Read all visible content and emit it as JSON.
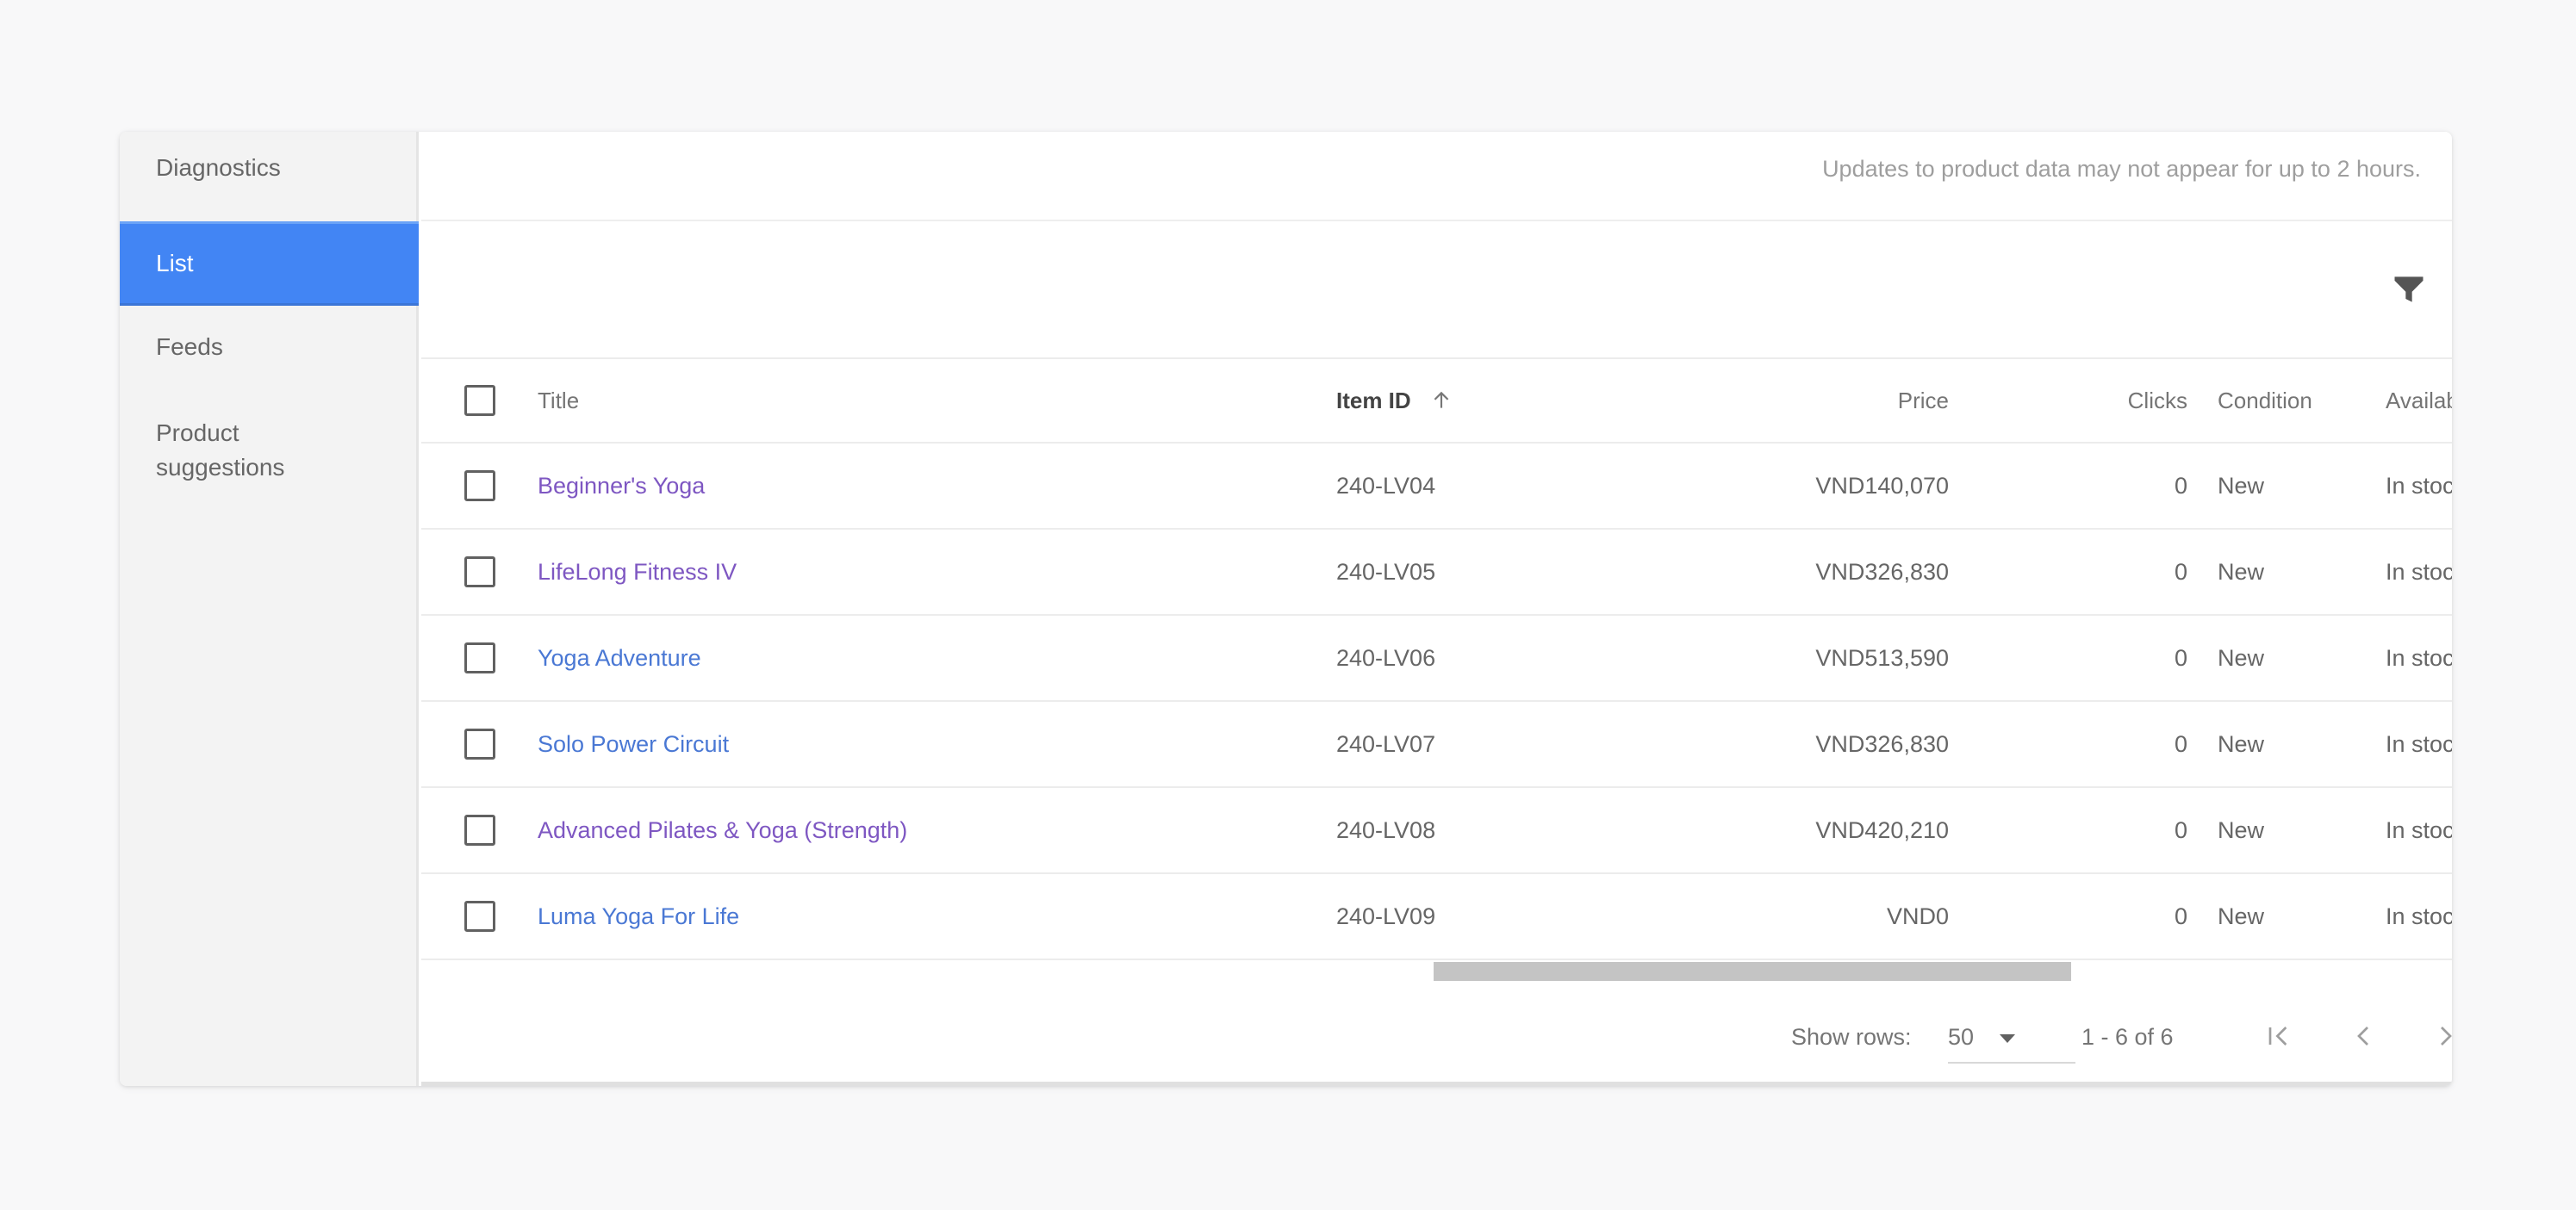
{
  "sidebar": {
    "items": [
      {
        "label": "Diagnostics"
      },
      {
        "label": "List"
      },
      {
        "label": "Feeds"
      },
      {
        "label": "Product suggestions"
      }
    ]
  },
  "notice": "Updates to product data may not appear for up to 2 hours.",
  "table": {
    "columns": {
      "title": "Title",
      "item_id": "Item ID",
      "price": "Price",
      "clicks": "Clicks",
      "condition": "Condition",
      "availability": "Availability"
    },
    "rows": [
      {
        "title": "Beginner's Yoga",
        "item_id": "240-LV04",
        "price": "VND140,070",
        "clicks": "0",
        "condition": "New",
        "availability": "In stock"
      },
      {
        "title": "LifeLong Fitness IV",
        "item_id": "240-LV05",
        "price": "VND326,830",
        "clicks": "0",
        "condition": "New",
        "availability": "In stock"
      },
      {
        "title": "Yoga Adventure",
        "item_id": "240-LV06",
        "price": "VND513,590",
        "clicks": "0",
        "condition": "New",
        "availability": "In stock"
      },
      {
        "title": "Solo Power Circuit",
        "item_id": "240-LV07",
        "price": "VND326,830",
        "clicks": "0",
        "condition": "New",
        "availability": "In stock"
      },
      {
        "title": "Advanced Pilates & Yoga (Strength)",
        "item_id": "240-LV08",
        "price": "VND420,210",
        "clicks": "0",
        "condition": "New",
        "availability": "In stock"
      },
      {
        "title": "Luma Yoga For Life",
        "item_id": "240-LV09",
        "price": "VND0",
        "clicks": "0",
        "condition": "New",
        "availability": "In stock"
      }
    ]
  },
  "footer": {
    "show_rows_label": "Show rows:",
    "rows_value": "50",
    "range": "1 - 6 of 6"
  },
  "icons": {
    "filter": "filter-icon",
    "sort": "arrow-up-icon",
    "first_page": "first-page-icon",
    "prev_page": "chevron-left-icon",
    "next_page": "chevron-right-icon",
    "last_page": "last-page-icon"
  },
  "colors": {
    "accent": "#4285f4",
    "visited_link": "#7e57c2",
    "link": "#4a78d4"
  }
}
